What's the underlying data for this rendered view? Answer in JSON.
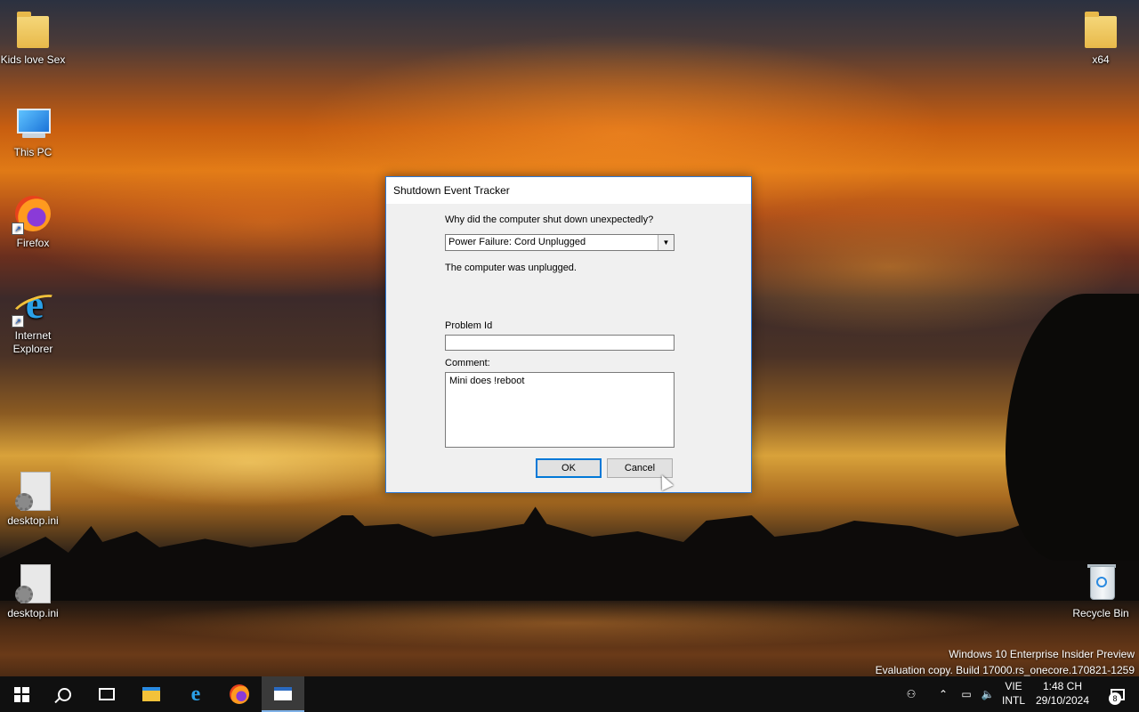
{
  "desktop": {
    "icons": [
      {
        "label": "Kids love Sex"
      },
      {
        "label": "This PC"
      },
      {
        "label": "Firefox"
      },
      {
        "label": "Internet Explorer"
      },
      {
        "label": "desktop.ini"
      },
      {
        "label": "desktop.ini"
      },
      {
        "label": "x64"
      },
      {
        "label": "Recycle Bin"
      }
    ]
  },
  "dialog": {
    "title": "Shutdown Event Tracker",
    "question": "Why did the computer shut down unexpectedly?",
    "reason_selected": "Power Failure: Cord Unplugged",
    "reason_description": "The computer was unplugged.",
    "problem_id_label": "Problem Id",
    "problem_id_value": "",
    "comment_label": "Comment:",
    "comment_value": "Mini does !reboot",
    "ok_label": "OK",
    "cancel_label": "Cancel"
  },
  "watermark": {
    "line1": "Windows 10 Enterprise Insider Preview",
    "line2": "Evaluation copy. Build 17000.rs_onecore.170821-1259"
  },
  "taskbar": {
    "language_line1": "VIE",
    "language_line2": "INTL",
    "time": "1:48 CH",
    "date": "29/10/2024",
    "notification_count": "8",
    "icons": [
      "windows-start-icon",
      "search-icon",
      "task-view-icon",
      "file-explorer-icon",
      "internet-explorer-icon",
      "firefox-icon",
      "shutdown-tracker-window-icon"
    ]
  },
  "colors": {
    "accent": "#0078d7",
    "dialog_bg": "#f0f0f0",
    "taskbar_bg": "#101010"
  }
}
